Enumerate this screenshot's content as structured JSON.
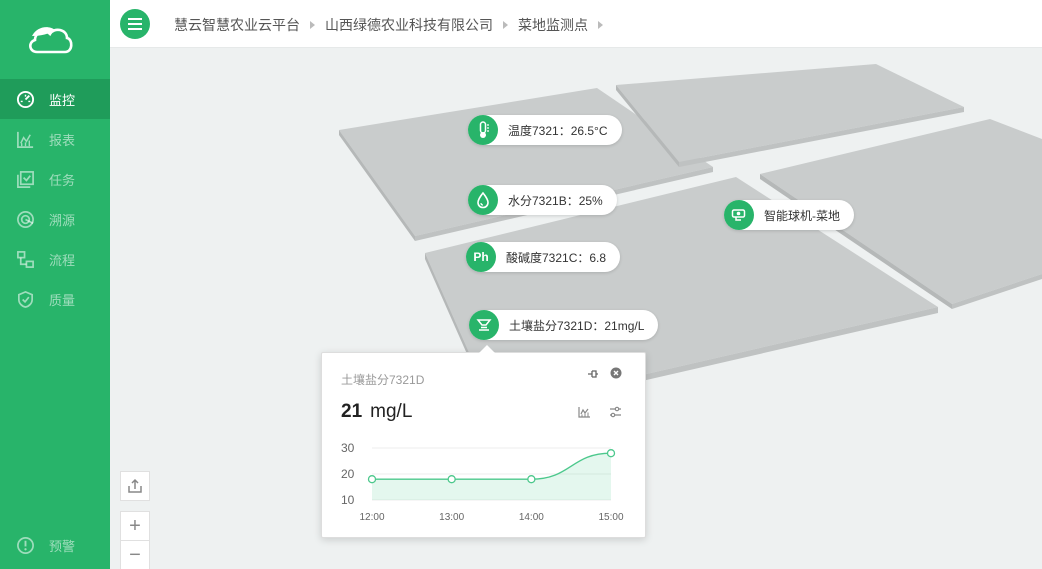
{
  "app": {
    "brand_color": "#28b46a",
    "logo_icon": "cloud-leaf-logo"
  },
  "sidebar": {
    "items": [
      {
        "label": "监控",
        "icon": "dashboard-gauge-icon",
        "active": true
      },
      {
        "label": "报表",
        "icon": "report-chart-icon",
        "active": false
      },
      {
        "label": "任务",
        "icon": "task-check-icon",
        "active": false
      },
      {
        "label": "溯源",
        "icon": "trace-source-icon",
        "active": false
      },
      {
        "label": "流程",
        "icon": "workflow-icon",
        "active": false
      },
      {
        "label": "质量",
        "icon": "quality-shield-icon",
        "active": false
      }
    ],
    "bottom_item": {
      "label": "预警",
      "icon": "alert-icon"
    }
  },
  "header": {
    "breadcrumb": [
      "慧云智慧农业云平台",
      "山西绿德农业科技有限公司",
      "菜地监测点"
    ]
  },
  "markers": [
    {
      "label": "温度7321：26.5°C",
      "icon": "thermometer-icon"
    },
    {
      "label": "水分7321B：25%",
      "icon": "water-drop-icon"
    },
    {
      "label": "酸碱度7321C：6.8",
      "icon": "ph-icon",
      "icon_text": "Ph"
    },
    {
      "label": "土壤盐分7321D：21mg/L",
      "icon": "soil-salinity-icon"
    },
    {
      "label": "智能球机-菜地",
      "icon": "camera-icon"
    }
  ],
  "popup": {
    "title": "土壤盐分7321D",
    "value": "21",
    "unit": "mg/L"
  },
  "chart_data": {
    "type": "area",
    "x": [
      "12:00",
      "13:00",
      "14:00",
      "15:00"
    ],
    "values": [
      18,
      18,
      18,
      28
    ],
    "ylim": [
      10,
      30
    ],
    "yticks": [
      10,
      20,
      30
    ],
    "color": "#4cc88c"
  },
  "controls": {
    "zoom_in": "+",
    "zoom_out": "−"
  }
}
